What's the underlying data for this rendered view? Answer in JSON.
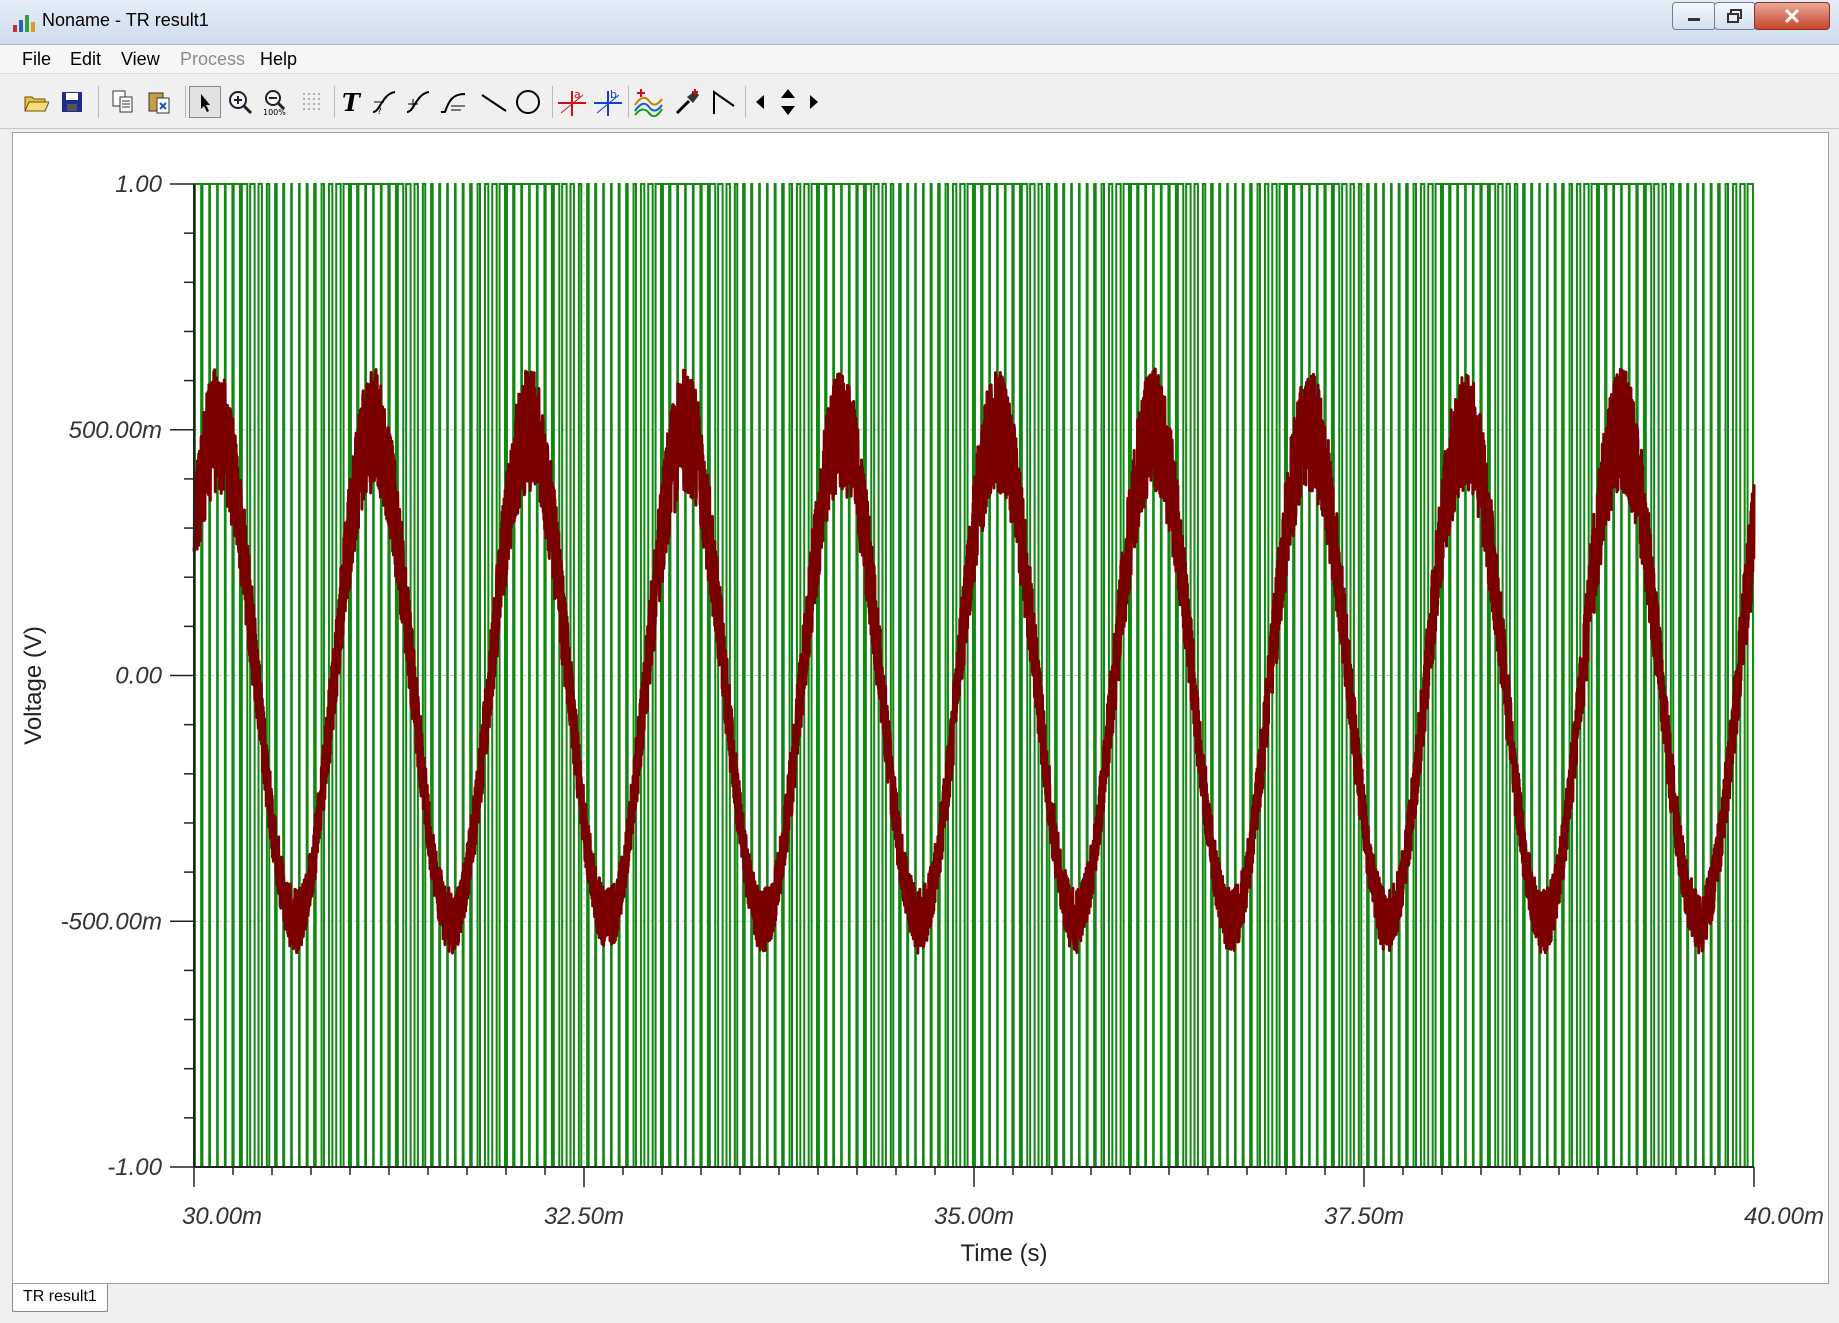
{
  "window": {
    "title": "Noname - TR result1"
  },
  "menu": {
    "items": [
      {
        "label": "File",
        "enabled": true
      },
      {
        "label": "Edit",
        "enabled": true
      },
      {
        "label": "View",
        "enabled": true
      },
      {
        "label": "Process",
        "enabled": false
      },
      {
        "label": "Help",
        "enabled": true
      }
    ]
  },
  "toolbar": {
    "buttons": [
      {
        "icon": "open-folder-icon"
      },
      {
        "icon": "save-icon"
      },
      {
        "icon": "copy-icon"
      },
      {
        "icon": "paste-icon"
      },
      {
        "icon": "pointer-icon",
        "pressed": true
      },
      {
        "icon": "zoom-in-icon"
      },
      {
        "icon": "zoom-100-icon",
        "text": "100%"
      },
      {
        "icon": "grid-icon"
      },
      {
        "icon": "text-icon",
        "text": "T"
      },
      {
        "icon": "curve-label-icon"
      },
      {
        "icon": "curve-label-2-icon"
      },
      {
        "icon": "curve-label-3-icon"
      },
      {
        "icon": "line-icon"
      },
      {
        "icon": "circle-icon"
      },
      {
        "icon": "cursor-a-icon",
        "text": "a"
      },
      {
        "icon": "cursor-b-icon",
        "text": "b"
      },
      {
        "icon": "curve-add-icon"
      },
      {
        "icon": "probe-icon"
      },
      {
        "icon": "angle-icon"
      },
      {
        "icon": "arrow-left-icon"
      },
      {
        "icon": "arrow-updown-icon"
      },
      {
        "icon": "arrow-right-icon"
      }
    ]
  },
  "tabs": [
    {
      "label": "TR result1",
      "active": true
    }
  ],
  "colors": {
    "pwm": "#118811",
    "sine": "#7a0000",
    "grid": "#c8c8c8"
  },
  "chart_data": {
    "type": "line",
    "xlabel": "Time (s)",
    "ylabel": "Voltage (V)",
    "xlim": [
      0.03,
      0.04
    ],
    "ylim": [
      -1.0,
      1.0
    ],
    "x_ticks": [
      {
        "value": 0.03,
        "label": "30.00m"
      },
      {
        "value": 0.0325,
        "label": "32.50m"
      },
      {
        "value": 0.035,
        "label": "35.00m"
      },
      {
        "value": 0.0375,
        "label": "37.50m"
      },
      {
        "value": 0.04,
        "label": "40.00m"
      }
    ],
    "y_ticks": [
      {
        "value": 1.0,
        "label": "1.00"
      },
      {
        "value": 0.5,
        "label": "500.00m"
      },
      {
        "value": 0.0,
        "label": "0.00"
      },
      {
        "value": -0.5,
        "label": "-500.00m"
      },
      {
        "value": -1.0,
        "label": "-1.00"
      }
    ],
    "grid": true,
    "series": [
      {
        "kind": "pwm-square",
        "levels": [
          -1.0,
          1.0
        ],
        "color": "#118811",
        "carrier_hz": 20000,
        "reference_amplitude": 0.5,
        "reference_hz": 1000
      },
      {
        "kind": "noisy-sine",
        "color": "#7a0000",
        "amplitude": 0.5,
        "frequency_hz": 1000,
        "start_time": 0.03,
        "ripple": 0.12
      }
    ]
  }
}
